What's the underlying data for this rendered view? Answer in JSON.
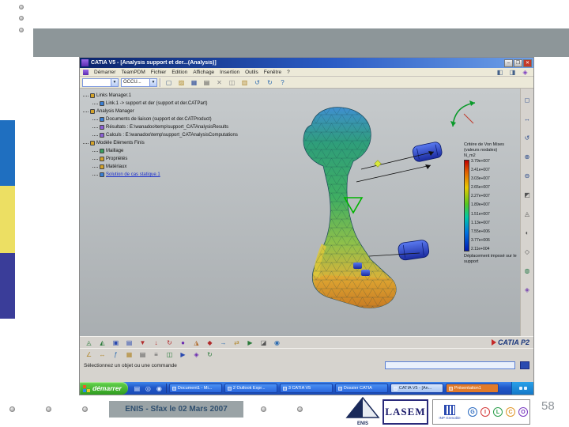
{
  "slide": {
    "footer_text": "ENIS - Sfax le 02 Mars 2007",
    "page_number": "58",
    "logos": {
      "lasem": "LASEM",
      "enis": "ENIS",
      "inp": "INP Grenoble",
      "gilco": [
        {
          "letter": "G",
          "color": "#2a6ac0"
        },
        {
          "letter": "I",
          "color": "#d43a3a"
        },
        {
          "letter": "L",
          "color": "#2a9e4a"
        },
        {
          "letter": "C",
          "color": "#e0962a"
        },
        {
          "letter": "O",
          "color": "#7a3ac0"
        }
      ]
    }
  },
  "catia": {
    "window_title": "CATIA V5 - [Analysis support et der...(Analysis)]",
    "titlebar_buttons": [
      {
        "name": "minimize-button",
        "glyph": "–"
      },
      {
        "name": "maximize-button",
        "glyph": "❐"
      },
      {
        "name": "close-button",
        "glyph": "✕",
        "bg": "#c43a2a",
        "color": "#ffffff"
      }
    ],
    "menus": [
      "Démarrer",
      "TeamPDM",
      "Fichier",
      "Edition",
      "Affichage",
      "Insertion",
      "Outils",
      "Fenêtre",
      "?"
    ],
    "toolbar_top": {
      "combo1_value": "",
      "combo2_value": "OCCU...",
      "icons": [
        {
          "name": "new-document-icon",
          "glyph": "▢",
          "color": "#44618a"
        },
        {
          "name": "open-icon",
          "glyph": "▨",
          "color": "#b08a2a"
        },
        {
          "name": "save-icon",
          "glyph": "▦",
          "color": "#2a4a9a"
        },
        {
          "name": "print-icon",
          "glyph": "▤",
          "color": "#555555"
        },
        {
          "name": "cut-icon",
          "glyph": "✕",
          "color": "#888888"
        },
        {
          "name": "copy-icon",
          "glyph": "◫",
          "color": "#888888"
        },
        {
          "name": "paste-icon",
          "glyph": "▥",
          "color": "#b0862a"
        },
        {
          "name": "undo-icon",
          "glyph": "↺",
          "color": "#2a6ab0"
        },
        {
          "name": "redo-icon",
          "glyph": "↻",
          "color": "#2a6ab0"
        },
        {
          "name": "help-icon",
          "glyph": "?",
          "color": "#2a6ab0"
        }
      ]
    },
    "menubar_icons": [
      {
        "name": "window-cascade-icon",
        "glyph": "◧",
        "color": "#44618a"
      },
      {
        "name": "window-tile-icon",
        "glyph": "◨",
        "color": "#44618a"
      },
      {
        "name": "workbench-icon",
        "glyph": "◈",
        "color": "#7a3ac0"
      }
    ],
    "tree_items": [
      {
        "name": "tree-item-links-manager",
        "label": "Links Manager.1",
        "indent": 0,
        "icon": "#d4a32a"
      },
      {
        "name": "tree-item-link1",
        "label": "Link.1 -> support et der (support et der.CATPart)",
        "indent": 1,
        "icon": "#3a7fd4"
      },
      {
        "name": "tree-item-analysis-manager",
        "label": "Analysis Manager",
        "indent": 0,
        "icon": "#d4a32a"
      },
      {
        "name": "tree-item-liaison",
        "label": "Documents de liaison (support et der.CATProduct)",
        "indent": 1,
        "icon": "#3a7fd4"
      },
      {
        "name": "tree-item-resultats",
        "label": "Résultats : E:\\wanadoo\\temp\\support_CATAnalysisResults",
        "indent": 1,
        "icon": "#8a5fd4"
      },
      {
        "name": "tree-item-calculs",
        "label": "Calculs : E:\\wanadoo\\temp\\support_CATAnalysisComputations",
        "indent": 1,
        "icon": "#8a5fd4"
      },
      {
        "name": "tree-item-modele-ef",
        "label": "Modèle Eléments Finis",
        "indent": 0,
        "icon": "#d4a32a"
      },
      {
        "name": "tree-item-maillage",
        "label": "Maillage",
        "indent": 1,
        "icon": "#3a9e5f"
      },
      {
        "name": "tree-item-proprietes",
        "label": "Propriétés",
        "indent": 1,
        "icon": "#d4a32a"
      },
      {
        "name": "tree-item-materiaux",
        "label": "Matériaux",
        "indent": 1,
        "icon": "#d4a32a"
      },
      {
        "name": "tree-item-solution",
        "label": "Solution de cas statique.1",
        "indent": 1,
        "link": true,
        "icon": "#3a7fd4"
      }
    ],
    "legend": {
      "title": "Critère de Von Mises (valeurs nodales)",
      "unit": "N_m2",
      "values": [
        "3.79e+007",
        "3.41e+007",
        "3.03e+007",
        "2.65e+007",
        "2.27e+007",
        "1.89e+007",
        "1.51e+007",
        "1.13e+007",
        "7.55e+006",
        "3.77e+006",
        "2.11e+004"
      ],
      "footer": "Déplacement imposé sur le support"
    },
    "right_toolbar_icons": [
      {
        "name": "fit-all-icon",
        "glyph": "◻",
        "color": "#2a4a8a"
      },
      {
        "name": "pan-icon",
        "glyph": "↔",
        "color": "#2a4a8a"
      },
      {
        "name": "rotate-icon",
        "glyph": "↺",
        "color": "#2a4a8a"
      },
      {
        "name": "zoom-in-icon",
        "glyph": "⊕",
        "color": "#2a4a8a"
      },
      {
        "name": "zoom-out-icon",
        "glyph": "⊖",
        "color": "#2a4a8a"
      },
      {
        "name": "normal-view-icon",
        "glyph": "◩",
        "color": "#555555"
      },
      {
        "name": "iso-view-icon",
        "glyph": "◬",
        "color": "#555555"
      },
      {
        "name": "shading-icon",
        "glyph": "◐",
        "color": "#555555"
      },
      {
        "name": "wireframe-icon",
        "glyph": "◇",
        "color": "#555555"
      },
      {
        "name": "hide-show-icon",
        "glyph": "◍",
        "color": "#2a7a4a"
      },
      {
        "name": "graph-tree-icon",
        "glyph": "◈",
        "color": "#7a4ab0"
      }
    ],
    "bottom_row1_icons": [
      {
        "name": "mesh-part-icon",
        "glyph": "◬",
        "color": "#2a7a3a"
      },
      {
        "name": "local-mesh-icon",
        "glyph": "◭",
        "color": "#2a7a3a"
      },
      {
        "name": "clamp-icon",
        "glyph": "▣",
        "color": "#2a4ab0"
      },
      {
        "name": "slider-restraint-icon",
        "glyph": "▤",
        "color": "#2a4ab0"
      },
      {
        "name": "pressure-icon",
        "glyph": "▼",
        "color": "#b02a2a"
      },
      {
        "name": "force-icon",
        "glyph": "↓",
        "color": "#b02a2a"
      },
      {
        "name": "moment-icon",
        "glyph": "↻",
        "color": "#b02a2a"
      },
      {
        "name": "compute-icon",
        "glyph": "●",
        "color": "#6a2ab0"
      },
      {
        "name": "deformation-icon",
        "glyph": "◮",
        "color": "#b06a2a"
      },
      {
        "name": "von-mises-stress-icon",
        "glyph": "◆",
        "color": "#b02a2a"
      },
      {
        "name": "displacement-icon",
        "glyph": "→",
        "color": "#2a6ab0"
      },
      {
        "name": "principal-stress-icon",
        "glyph": "⇄",
        "color": "#b0862a"
      },
      {
        "name": "animate-icon",
        "glyph": "▶",
        "color": "#2a7a3a"
      },
      {
        "name": "cut-plane-icon",
        "glyph": "◪",
        "color": "#555555"
      },
      {
        "name": "amplification-icon",
        "glyph": "◉",
        "color": "#2a6ab0"
      }
    ],
    "bottom_row2_icons": [
      {
        "name": "measure-angle-icon",
        "glyph": "∠",
        "color": "#b0862a"
      },
      {
        "name": "measure-between-icon",
        "glyph": "↔",
        "color": "#b0862a"
      },
      {
        "name": "knowledge-formula-icon",
        "glyph": "ƒ",
        "color": "#2a6ab0"
      },
      {
        "name": "catalog-icon",
        "glyph": "▦",
        "color": "#b0862a"
      },
      {
        "name": "report-icon",
        "glyph": "▤",
        "color": "#555555"
      },
      {
        "name": "historic-icon",
        "glyph": "≡",
        "color": "#555555"
      },
      {
        "name": "image-capture-icon",
        "glyph": "◫",
        "color": "#2a7a3a"
      },
      {
        "name": "player-icon",
        "glyph": "▶",
        "color": "#2a4ab0"
      },
      {
        "name": "groups-icon",
        "glyph": "◈",
        "color": "#6a2ab0"
      },
      {
        "name": "refresh-icon",
        "glyph": "↻",
        "color": "#2a7a3a"
      }
    ],
    "catia_logo": "CATIA P2",
    "status_text": "Sélectionnez un objet ou une commande",
    "taskbar": {
      "start_label": "démarrer",
      "quick_launch": [
        {
          "name": "show-desktop-icon",
          "glyph": "▤"
        },
        {
          "name": "browser-icon",
          "glyph": "◎"
        },
        {
          "name": "mail-icon",
          "glyph": "◉"
        }
      ],
      "tasks": [
        {
          "name": "task-document1",
          "label": "Document1 - Mi..."
        },
        {
          "name": "task-outlook",
          "label": "2 Outlook Expr..."
        },
        {
          "name": "task-catia-2",
          "label": "3 CATIA V5"
        },
        {
          "name": "task-dossier",
          "label": "Dossier CATIA"
        },
        {
          "name": "task-catia-active",
          "label": "CATIA V5 - [An...",
          "active": true
        },
        {
          "name": "task-presentation",
          "label": "Présentation1",
          "bg": "#e07a2a"
        }
      ]
    }
  }
}
